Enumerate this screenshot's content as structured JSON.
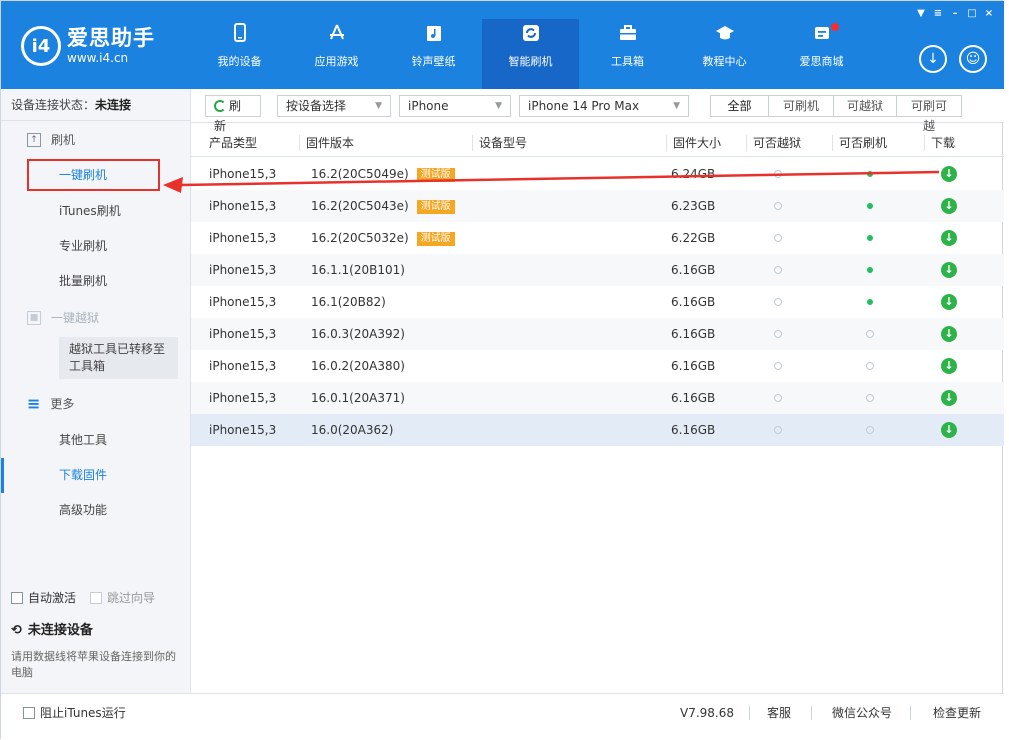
{
  "header": {
    "logo_cn": "爱思助手",
    "logo_en": "www.i4.cn",
    "logo_mark": "i4",
    "nav": [
      {
        "label": "我的设备",
        "icon": "phone-icon"
      },
      {
        "label": "应用游戏",
        "icon": "app-store-icon"
      },
      {
        "label": "铃声壁纸",
        "icon": "music-icon"
      },
      {
        "label": "智能刷机",
        "icon": "flash-icon",
        "active": true
      },
      {
        "label": "工具箱",
        "icon": "toolbox-icon"
      },
      {
        "label": "教程中心",
        "icon": "graduation-cap-icon"
      },
      {
        "label": "爱思商城",
        "icon": "shop-icon"
      }
    ]
  },
  "sidebar": {
    "conn_label": "设备连接状态：",
    "conn_value": "未连接",
    "flash_section": "刷机",
    "flash_items": [
      "一键刷机",
      "iTunes刷机",
      "专业刷机",
      "批量刷机"
    ],
    "jailbreak_section": "一键越狱",
    "jailbreak_note": "越狱工具已转移至工具箱",
    "more_section": "更多",
    "more_items": [
      "其他工具",
      "下载固件",
      "高级功能"
    ],
    "auto_activate": "自动激活",
    "skip_guide": "跳过向导",
    "no_device_title": "未连接设备",
    "no_device_desc": "请用数据线将苹果设备连接到你的电脑"
  },
  "toolbar": {
    "refresh": "刷新",
    "select_by_device": "按设备选择",
    "device_type": "iPhone",
    "model": "iPhone 14 Pro Max",
    "filters": [
      "全部",
      "可刷机",
      "可越狱",
      "可刷可越"
    ]
  },
  "table": {
    "headers": [
      "产品类型",
      "固件版本",
      "设备型号",
      "固件大小",
      "可否越狱",
      "可否刷机",
      "下载"
    ],
    "beta_label": "测试版",
    "rows": [
      {
        "type": "iPhone15,3",
        "version": "16.2(20C5049e)",
        "beta": true,
        "size": "6.24GB",
        "jailbreak": false,
        "flash": true
      },
      {
        "type": "iPhone15,3",
        "version": "16.2(20C5043e)",
        "beta": true,
        "size": "6.23GB",
        "jailbreak": false,
        "flash": true
      },
      {
        "type": "iPhone15,3",
        "version": "16.2(20C5032e)",
        "beta": true,
        "size": "6.22GB",
        "jailbreak": false,
        "flash": true
      },
      {
        "type": "iPhone15,3",
        "version": "16.1.1(20B101)",
        "beta": false,
        "size": "6.16GB",
        "jailbreak": false,
        "flash": true
      },
      {
        "type": "iPhone15,3",
        "version": "16.1(20B82)",
        "beta": false,
        "size": "6.16GB",
        "jailbreak": false,
        "flash": true
      },
      {
        "type": "iPhone15,3",
        "version": "16.0.3(20A392)",
        "beta": false,
        "size": "6.16GB",
        "jailbreak": false,
        "flash": false
      },
      {
        "type": "iPhone15,3",
        "version": "16.0.2(20A380)",
        "beta": false,
        "size": "6.16GB",
        "jailbreak": false,
        "flash": false
      },
      {
        "type": "iPhone15,3",
        "version": "16.0.1(20A371)",
        "beta": false,
        "size": "6.16GB",
        "jailbreak": false,
        "flash": false
      },
      {
        "type": "iPhone15,3",
        "version": "16.0(20A362)",
        "beta": false,
        "size": "6.16GB",
        "jailbreak": false,
        "flash": false
      }
    ]
  },
  "statusbar": {
    "block_itunes": "阻止iTunes运行",
    "version": "V7.98.68",
    "service": "客服",
    "wechat": "微信公众号",
    "check_update": "检查更新"
  },
  "colors": {
    "brand": "#1b82e0",
    "active_nav": "#1667c8",
    "beta": "#f5a623",
    "ok": "#20c05c",
    "annotation": "#e8312b"
  }
}
